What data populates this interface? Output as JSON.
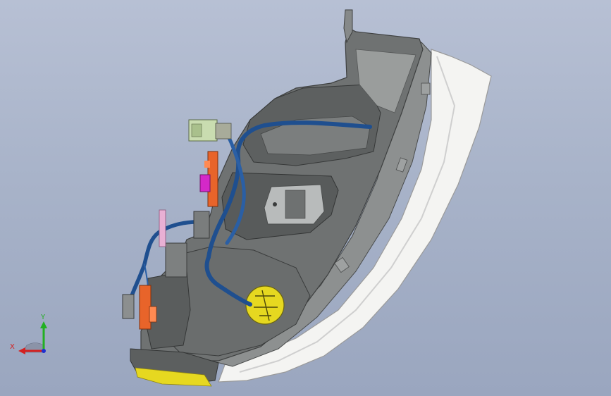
{
  "viewport": {
    "background_top": "#b7c0d4",
    "background_bottom": "#9aa6bf"
  },
  "triad": {
    "x_label": "X",
    "y_label": "Y",
    "x_color": "#d42020",
    "y_color": "#22b022",
    "z_color": "#2030d0"
  },
  "model": {
    "description_icon": "headlamp-assembly-icon",
    "lens_color": "#f4f4f2",
    "housing_color": "#6f7272",
    "wire_color": "#1f4f8f",
    "connector_orange": "#e8642a",
    "connector_magenta": "#d428c8",
    "connector_green": "#c9dcb0",
    "cap_yellow": "#e6d820",
    "pin_pink": "#e8b0d4"
  }
}
